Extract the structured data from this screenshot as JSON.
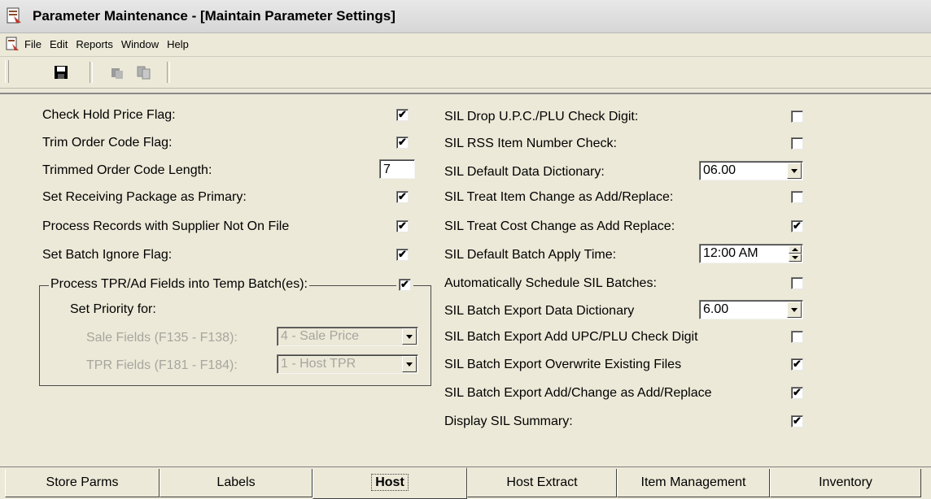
{
  "window": {
    "title": "Parameter Maintenance - [Maintain Parameter Settings]"
  },
  "menu": {
    "items": [
      "File",
      "Edit",
      "Reports",
      "Window",
      "Help"
    ]
  },
  "toolbar": {
    "buttons": [
      "save-icon",
      "paste-icon",
      "copy-icon"
    ]
  },
  "left": {
    "check_hold": {
      "label": "Check Hold Price Flag:",
      "checked": true
    },
    "trim_order": {
      "label": "Trim Order Code Flag:",
      "checked": true
    },
    "trim_len": {
      "label": "Trimmed Order Code Length:",
      "value": "7"
    },
    "recv_pkg": {
      "label": "Set Receiving Package as Primary:",
      "checked": true
    },
    "proc_supplier": {
      "label": "Process Records with Supplier Not On File",
      "checked": true
    },
    "batch_ignore": {
      "label": "Set Batch Ignore Flag:",
      "checked": true
    },
    "tpr_group": {
      "label": "Process TPR/Ad Fields into Temp Batch(es):",
      "checked": true,
      "priority_label": "Set Priority for:",
      "sale_label": "Sale Fields (F135 - F138):",
      "sale_value": "4 - Sale Price",
      "tpr_label": "TPR Fields (F181 - F184):",
      "tpr_value": "1 - Host TPR"
    }
  },
  "right": {
    "drop_upc": {
      "label": "SIL Drop U.P.C./PLU Check Digit:",
      "checked": false
    },
    "rss_check": {
      "label": "SIL RSS Item Number Check:",
      "checked": false
    },
    "data_dict": {
      "label": "SIL Default Data Dictionary:",
      "value": "06.00"
    },
    "item_change": {
      "label": "SIL Treat Item Change as Add/Replace:",
      "checked": false
    },
    "cost_change": {
      "label": "SIL Treat Cost Change as Add Replace:",
      "checked": true
    },
    "apply_time": {
      "label": "SIL Default Batch Apply Time:",
      "value": "12:00 AM"
    },
    "auto_sched": {
      "label": "Automatically Schedule SIL Batches:",
      "checked": false
    },
    "export_dict": {
      "label": "SIL Batch Export Data Dictionary",
      "value": "6.00"
    },
    "export_upc": {
      "label": "SIL Batch Export Add UPC/PLU Check Digit",
      "checked": false
    },
    "export_overwrite": {
      "label": "SIL Batch Export Overwrite Existing Files",
      "checked": true
    },
    "export_addchange": {
      "label": "SIL Batch Export Add/Change as Add/Replace",
      "checked": true
    },
    "display_summary": {
      "label": "Display SIL Summary:",
      "checked": true
    }
  },
  "tabs": {
    "store_parms": "Store Parms",
    "labels": "Labels",
    "host": "Host",
    "host_extract": "Host Extract",
    "item_mgmt": "Item Management",
    "inventory": "Inventory",
    "active": "Host"
  }
}
